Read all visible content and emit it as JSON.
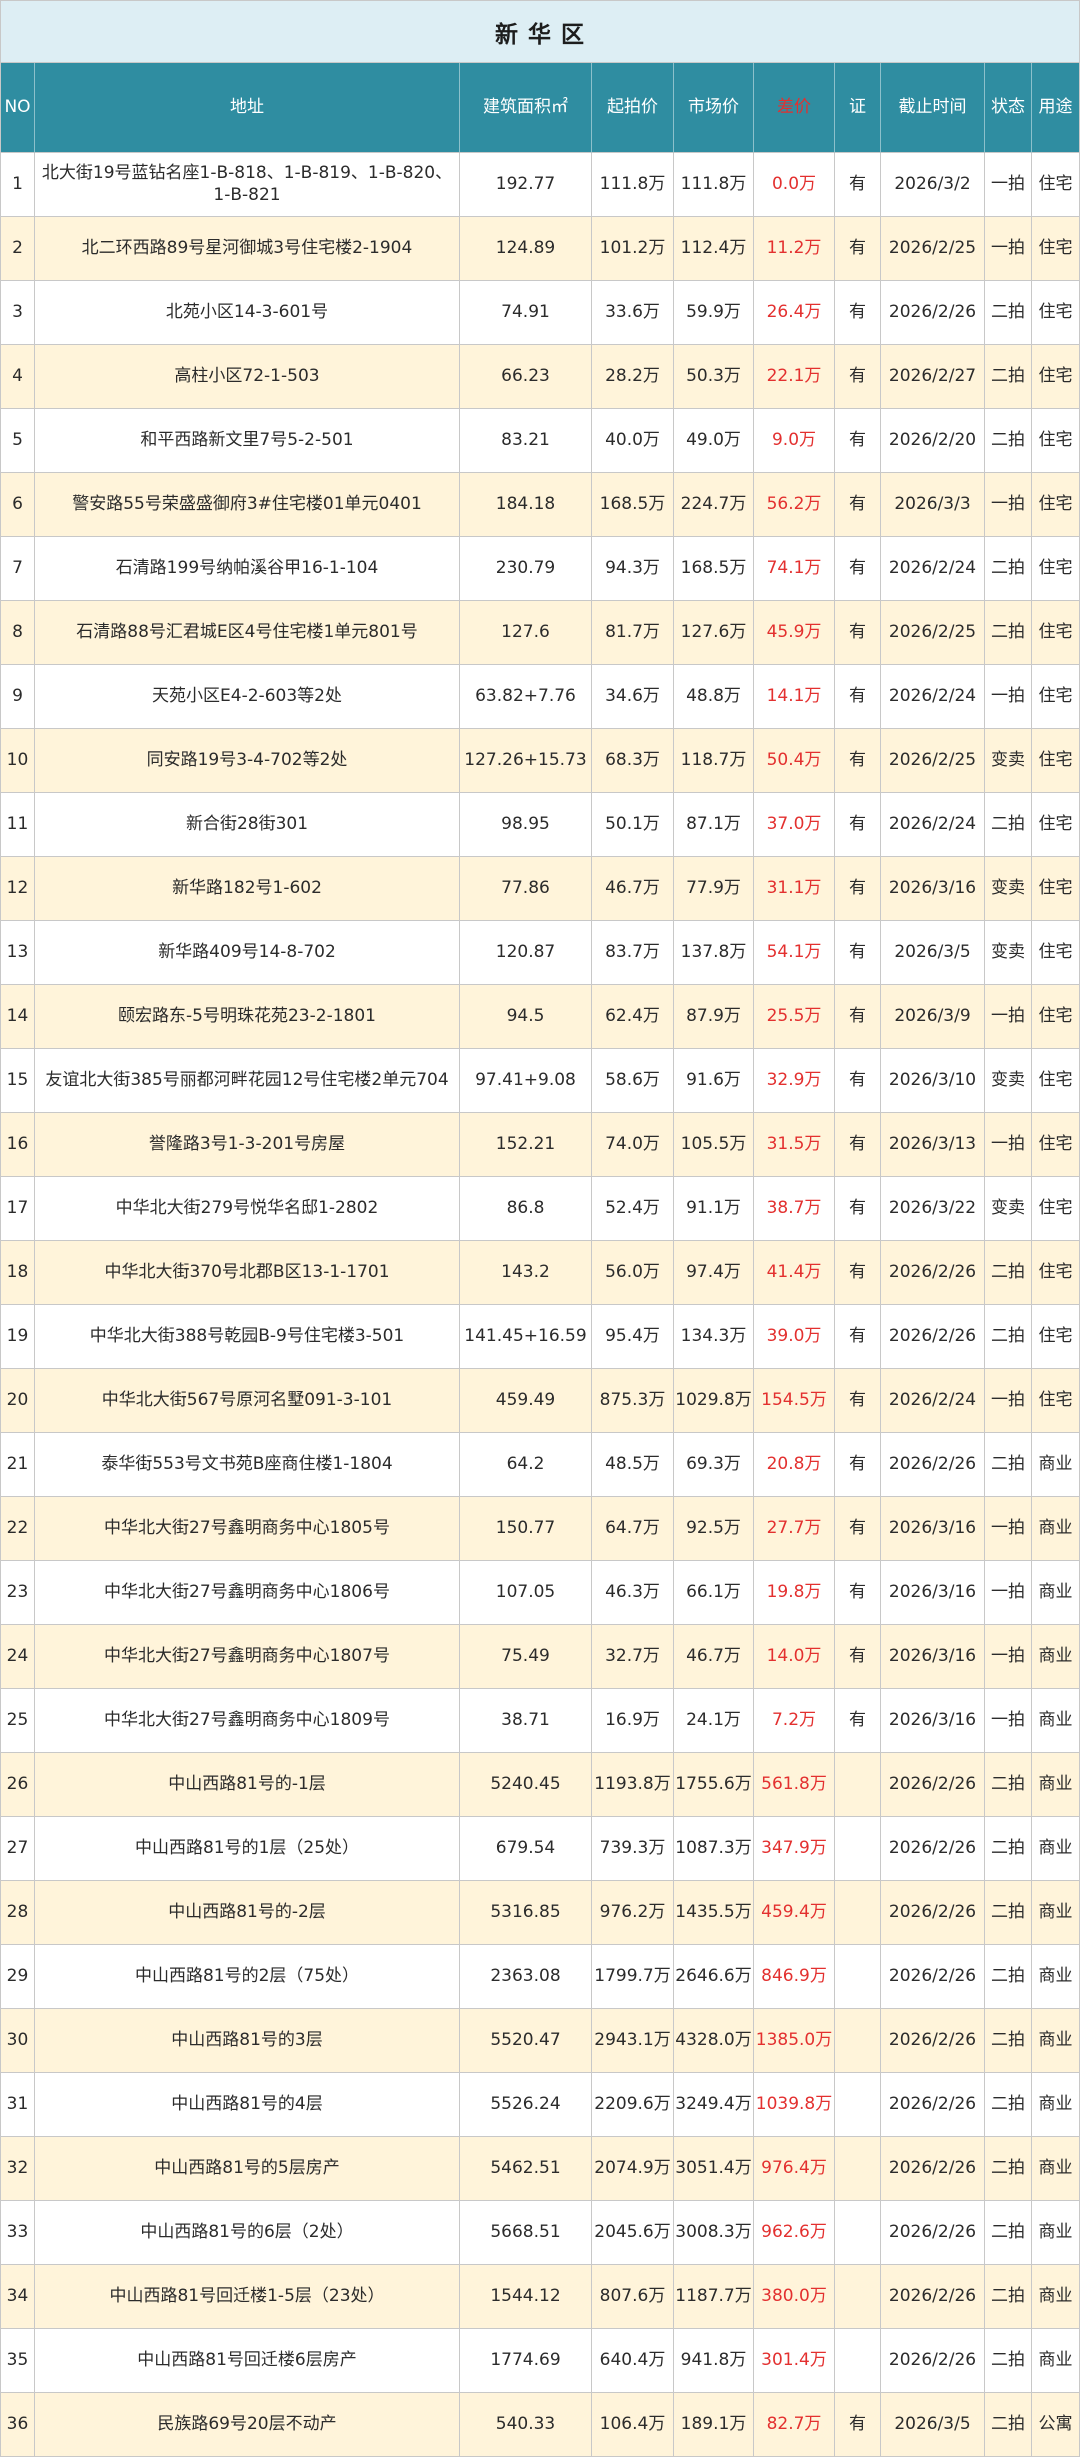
{
  "title": "新 华 区",
  "columns": [
    "NO",
    "地址",
    "建筑面积㎡",
    "起拍价",
    "市场价",
    "差价",
    "证",
    "截止时间",
    "状态",
    "用途"
  ],
  "colors": {
    "title_bg": "#DDEEF4",
    "header_bg": "#2F8DA1",
    "header_text": "#FFFFFF",
    "accent": "#E3302F",
    "row_bg": "#FFFFFF",
    "row_alt_bg": "#FFF4DA",
    "border": "#C8C8C8",
    "text": "#2B2B2B"
  },
  "rows": [
    {
      "no": "1",
      "address": "北大街19号蓝钻名座1-B-818、1-B-819、1-B-820、1-B-821",
      "area": "192.77",
      "start_price": "111.8万",
      "market_price": "111.8万",
      "diff": "0.0万",
      "cert": "有",
      "deadline": "2026/3/2",
      "status": "一拍",
      "usage": "住宅"
    },
    {
      "no": "2",
      "address": "北二环西路89号星河御城3号住宅楼2-1904",
      "area": "124.89",
      "start_price": "101.2万",
      "market_price": "112.4万",
      "diff": "11.2万",
      "cert": "有",
      "deadline": "2026/2/25",
      "status": "一拍",
      "usage": "住宅"
    },
    {
      "no": "3",
      "address": "北苑小区14-3-601号",
      "area": "74.91",
      "start_price": "33.6万",
      "market_price": "59.9万",
      "diff": "26.4万",
      "cert": "有",
      "deadline": "2026/2/26",
      "status": "二拍",
      "usage": "住宅"
    },
    {
      "no": "4",
      "address": "高柱小区72-1-503",
      "area": "66.23",
      "start_price": "28.2万",
      "market_price": "50.3万",
      "diff": "22.1万",
      "cert": "有",
      "deadline": "2026/2/27",
      "status": "二拍",
      "usage": "住宅"
    },
    {
      "no": "5",
      "address": "和平西路新文里7号5-2-501",
      "area": "83.21",
      "start_price": "40.0万",
      "market_price": "49.0万",
      "diff": "9.0万",
      "cert": "有",
      "deadline": "2026/2/20",
      "status": "二拍",
      "usage": "住宅"
    },
    {
      "no": "6",
      "address": "警安路55号荣盛盛御府3#住宅楼01单元0401",
      "area": "184.18",
      "start_price": "168.5万",
      "market_price": "224.7万",
      "diff": "56.2万",
      "cert": "有",
      "deadline": "2026/3/3",
      "status": "一拍",
      "usage": "住宅"
    },
    {
      "no": "7",
      "address": "石清路199号纳帕溪谷甲16-1-104",
      "area": "230.79",
      "start_price": "94.3万",
      "market_price": "168.5万",
      "diff": "74.1万",
      "cert": "有",
      "deadline": "2026/2/24",
      "status": "二拍",
      "usage": "住宅"
    },
    {
      "no": "8",
      "address": "石清路88号汇君城E区4号住宅楼1单元801号",
      "area": "127.6",
      "start_price": "81.7万",
      "market_price": "127.6万",
      "diff": "45.9万",
      "cert": "有",
      "deadline": "2026/2/25",
      "status": "二拍",
      "usage": "住宅"
    },
    {
      "no": "9",
      "address": "天苑小区E4-2-603等2处",
      "area": "63.82+7.76",
      "start_price": "34.6万",
      "market_price": "48.8万",
      "diff": "14.1万",
      "cert": "有",
      "deadline": "2026/2/24",
      "status": "一拍",
      "usage": "住宅"
    },
    {
      "no": "10",
      "address": "同安路19号3-4-702等2处",
      "area": "127.26+15.73",
      "start_price": "68.3万",
      "market_price": "118.7万",
      "diff": "50.4万",
      "cert": "有",
      "deadline": "2026/2/25",
      "status": "变卖",
      "usage": "住宅"
    },
    {
      "no": "11",
      "address": "新合街28街301",
      "area": "98.95",
      "start_price": "50.1万",
      "market_price": "87.1万",
      "diff": "37.0万",
      "cert": "有",
      "deadline": "2026/2/24",
      "status": "二拍",
      "usage": "住宅"
    },
    {
      "no": "12",
      "address": "新华路182号1-602",
      "area": "77.86",
      "start_price": "46.7万",
      "market_price": "77.9万",
      "diff": "31.1万",
      "cert": "有",
      "deadline": "2026/3/16",
      "status": "变卖",
      "usage": "住宅"
    },
    {
      "no": "13",
      "address": "新华路409号14-8-702",
      "area": "120.87",
      "start_price": "83.7万",
      "market_price": "137.8万",
      "diff": "54.1万",
      "cert": "有",
      "deadline": "2026/3/5",
      "status": "变卖",
      "usage": "住宅"
    },
    {
      "no": "14",
      "address": "颐宏路东-5号明珠花苑23-2-1801",
      "area": "94.5",
      "start_price": "62.4万",
      "market_price": "87.9万",
      "diff": "25.5万",
      "cert": "有",
      "deadline": "2026/3/9",
      "status": "一拍",
      "usage": "住宅"
    },
    {
      "no": "15",
      "address": "友谊北大街385号丽都河畔花园12号住宅楼2单元704",
      "area": "97.41+9.08",
      "start_price": "58.6万",
      "market_price": "91.6万",
      "diff": "32.9万",
      "cert": "有",
      "deadline": "2026/3/10",
      "status": "变卖",
      "usage": "住宅"
    },
    {
      "no": "16",
      "address": "誉隆路3号1-3-201号房屋",
      "area": "152.21",
      "start_price": "74.0万",
      "market_price": "105.5万",
      "diff": "31.5万",
      "cert": "有",
      "deadline": "2026/3/13",
      "status": "一拍",
      "usage": "住宅"
    },
    {
      "no": "17",
      "address": "中华北大街279号悦华名邸1-2802",
      "area": "86.8",
      "start_price": "52.4万",
      "market_price": "91.1万",
      "diff": "38.7万",
      "cert": "有",
      "deadline": "2026/3/22",
      "status": "变卖",
      "usage": "住宅"
    },
    {
      "no": "18",
      "address": "中华北大街370号北郡B区13-1-1701",
      "area": "143.2",
      "start_price": "56.0万",
      "market_price": "97.4万",
      "diff": "41.4万",
      "cert": "有",
      "deadline": "2026/2/26",
      "status": "二拍",
      "usage": "住宅"
    },
    {
      "no": "19",
      "address": "中华北大街388号乾园B-9号住宅楼3-501",
      "area": "141.45+16.59",
      "start_price": "95.4万",
      "market_price": "134.3万",
      "diff": "39.0万",
      "cert": "有",
      "deadline": "2026/2/26",
      "status": "二拍",
      "usage": "住宅"
    },
    {
      "no": "20",
      "address": "中华北大街567号原河名墅091-3-101",
      "area": "459.49",
      "start_price": "875.3万",
      "market_price": "1029.8万",
      "diff": "154.5万",
      "cert": "有",
      "deadline": "2026/2/24",
      "status": "一拍",
      "usage": "住宅"
    },
    {
      "no": "21",
      "address": "泰华街553号文书苑B座商住楼1-1804",
      "area": "64.2",
      "start_price": "48.5万",
      "market_price": "69.3万",
      "diff": "20.8万",
      "cert": "有",
      "deadline": "2026/2/26",
      "status": "二拍",
      "usage": "商业"
    },
    {
      "no": "22",
      "address": "中华北大街27号鑫明商务中心1805号",
      "area": "150.77",
      "start_price": "64.7万",
      "market_price": "92.5万",
      "diff": "27.7万",
      "cert": "有",
      "deadline": "2026/3/16",
      "status": "一拍",
      "usage": "商业"
    },
    {
      "no": "23",
      "address": "中华北大街27号鑫明商务中心1806号",
      "area": "107.05",
      "start_price": "46.3万",
      "market_price": "66.1万",
      "diff": "19.8万",
      "cert": "有",
      "deadline": "2026/3/16",
      "status": "一拍",
      "usage": "商业"
    },
    {
      "no": "24",
      "address": "中华北大街27号鑫明商务中心1807号",
      "area": "75.49",
      "start_price": "32.7万",
      "market_price": "46.7万",
      "diff": "14.0万",
      "cert": "有",
      "deadline": "2026/3/16",
      "status": "一拍",
      "usage": "商业"
    },
    {
      "no": "25",
      "address": "中华北大街27号鑫明商务中心1809号",
      "area": "38.71",
      "start_price": "16.9万",
      "market_price": "24.1万",
      "diff": "7.2万",
      "cert": "有",
      "deadline": "2026/3/16",
      "status": "一拍",
      "usage": "商业"
    },
    {
      "no": "26",
      "address": "中山西路81号的-1层",
      "area": "5240.45",
      "start_price": "1193.8万",
      "market_price": "1755.6万",
      "diff": "561.8万",
      "cert": "",
      "deadline": "2026/2/26",
      "status": "二拍",
      "usage": "商业"
    },
    {
      "no": "27",
      "address": "中山西路81号的1层（25处）",
      "area": "679.54",
      "start_price": "739.3万",
      "market_price": "1087.3万",
      "diff": "347.9万",
      "cert": "",
      "deadline": "2026/2/26",
      "status": "二拍",
      "usage": "商业"
    },
    {
      "no": "28",
      "address": "中山西路81号的-2层",
      "area": "5316.85",
      "start_price": "976.2万",
      "market_price": "1435.5万",
      "diff": "459.4万",
      "cert": "",
      "deadline": "2026/2/26",
      "status": "二拍",
      "usage": "商业"
    },
    {
      "no": "29",
      "address": "中山西路81号的2层（75处）",
      "area": "2363.08",
      "start_price": "1799.7万",
      "market_price": "2646.6万",
      "diff": "846.9万",
      "cert": "",
      "deadline": "2026/2/26",
      "status": "二拍",
      "usage": "商业"
    },
    {
      "no": "30",
      "address": "中山西路81号的3层",
      "area": "5520.47",
      "start_price": "2943.1万",
      "market_price": "4328.0万",
      "diff": "1385.0万",
      "cert": "",
      "deadline": "2026/2/26",
      "status": "二拍",
      "usage": "商业"
    },
    {
      "no": "31",
      "address": "中山西路81号的4层",
      "area": "5526.24",
      "start_price": "2209.6万",
      "market_price": "3249.4万",
      "diff": "1039.8万",
      "cert": "",
      "deadline": "2026/2/26",
      "status": "二拍",
      "usage": "商业"
    },
    {
      "no": "32",
      "address": "中山西路81号的5层房产",
      "area": "5462.51",
      "start_price": "2074.9万",
      "market_price": "3051.4万",
      "diff": "976.4万",
      "cert": "",
      "deadline": "2026/2/26",
      "status": "二拍",
      "usage": "商业"
    },
    {
      "no": "33",
      "address": "中山西路81号的6层（2处）",
      "area": "5668.51",
      "start_price": "2045.6万",
      "market_price": "3008.3万",
      "diff": "962.6万",
      "cert": "",
      "deadline": "2026/2/26",
      "status": "二拍",
      "usage": "商业"
    },
    {
      "no": "34",
      "address": "中山西路81号回迁楼1-5层（23处）",
      "area": "1544.12",
      "start_price": "807.6万",
      "market_price": "1187.7万",
      "diff": "380.0万",
      "cert": "",
      "deadline": "2026/2/26",
      "status": "二拍",
      "usage": "商业"
    },
    {
      "no": "35",
      "address": "中山西路81号回迁楼6层房产",
      "area": "1774.69",
      "start_price": "640.4万",
      "market_price": "941.8万",
      "diff": "301.4万",
      "cert": "",
      "deadline": "2026/2/26",
      "status": "二拍",
      "usage": "商业"
    },
    {
      "no": "36",
      "address": "民族路69号20层不动产",
      "area": "540.33",
      "start_price": "106.4万",
      "market_price": "189.1万",
      "diff": "82.7万",
      "cert": "有",
      "deadline": "2026/3/5",
      "status": "二拍",
      "usage": "公寓"
    }
  ]
}
